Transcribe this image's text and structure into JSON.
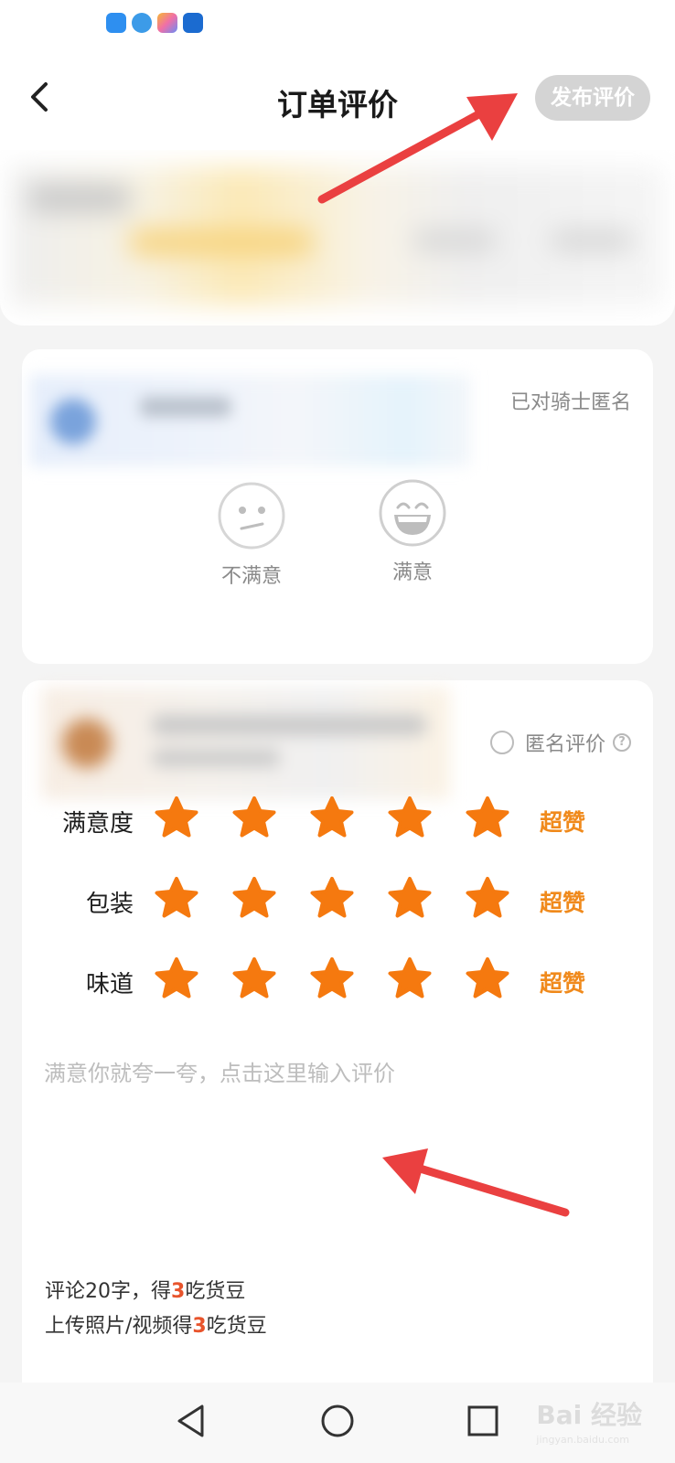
{
  "status_bar": {
    "icons": [
      "weather-icon",
      "telegram-icon",
      "app-icon",
      "bot-icon"
    ],
    "icon_colors": [
      "#2e8ff0",
      "#3c9be8",
      "#f06fa7",
      "#1b6bd0"
    ]
  },
  "header": {
    "title": "订单评价",
    "publish_label": "发布评价"
  },
  "rider_section": {
    "anonymous_note": "已对骑士匿名",
    "options": [
      {
        "icon": "neutral-face-icon",
        "label": "不满意"
      },
      {
        "icon": "laughing-face-icon",
        "label": "满意"
      }
    ]
  },
  "shop_section": {
    "anonymous_label": "匿名评价",
    "help_icon": "question-circle-icon",
    "ratings": [
      {
        "label": "满意度",
        "stars": 5,
        "max": 5,
        "word": "超赞"
      },
      {
        "label": "包装",
        "stars": 5,
        "max": 5,
        "word": "超赞"
      },
      {
        "label": "味道",
        "stars": 5,
        "max": 5,
        "word": "超赞"
      }
    ],
    "star_color": "#f5790f",
    "comment_placeholder": "满意你就夸一夸，点击这里输入评价",
    "comment_value": "",
    "reward_line1_prefix": "评论20字，得",
    "reward_line1_num": "3",
    "reward_line1_suffix": "吃货豆",
    "reward_line2_prefix": "上传照片/视频得",
    "reward_line2_num": "3",
    "reward_line2_suffix": "吃货豆",
    "reward_accent": "#e8542c"
  },
  "navbar": {
    "buttons": [
      "back-triangle-icon",
      "home-circle-icon",
      "recents-square-icon"
    ],
    "watermark_main": "Bai 经验",
    "watermark_sub": "jingyan.baidu.com"
  },
  "annotation_arrow_color": "#ea4040"
}
